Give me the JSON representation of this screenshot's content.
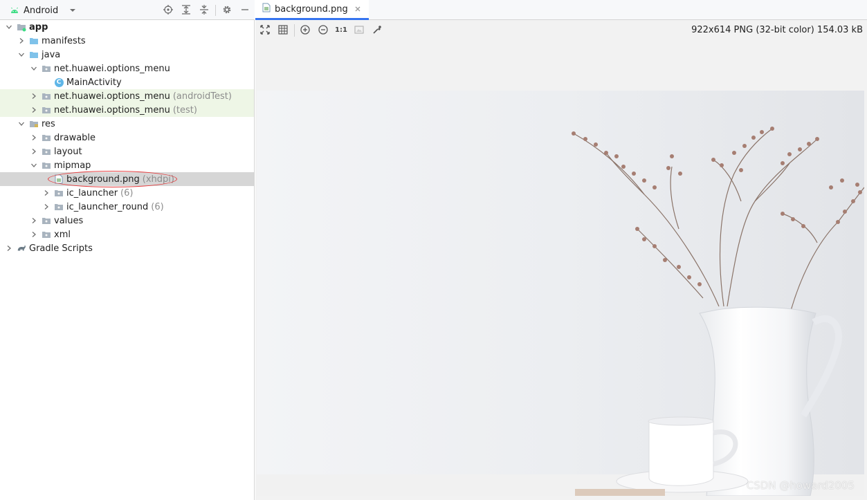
{
  "project_panel": {
    "view_label": "Android",
    "toolbar": [
      "locate-icon",
      "expand-all-icon",
      "collapse-all-icon",
      "gear-icon",
      "minimize-icon"
    ],
    "tree": [
      {
        "label": "app",
        "hint": "",
        "depth": 0,
        "expanded": true,
        "icon": "module-folder-icon",
        "bold": true
      },
      {
        "label": "manifests",
        "hint": "",
        "depth": 1,
        "expanded": false,
        "icon": "folder-icon"
      },
      {
        "label": "java",
        "hint": "",
        "depth": 1,
        "expanded": true,
        "icon": "folder-icon"
      },
      {
        "label": "net.huawei.options_menu",
        "hint": "",
        "depth": 2,
        "expanded": true,
        "icon": "package-icon"
      },
      {
        "label": "MainActivity",
        "hint": "",
        "depth": 3,
        "leaf": true,
        "icon": "class-icon"
      },
      {
        "label": "net.huawei.options_menu",
        "hint": "(androidTest)",
        "depth": 2,
        "expanded": false,
        "icon": "package-icon",
        "highlight": "green"
      },
      {
        "label": "net.huawei.options_menu",
        "hint": "(test)",
        "depth": 2,
        "expanded": false,
        "icon": "package-icon",
        "highlight": "green"
      },
      {
        "label": "res",
        "hint": "",
        "depth": 1,
        "expanded": true,
        "icon": "resources-folder-icon"
      },
      {
        "label": "drawable",
        "hint": "",
        "depth": 2,
        "expanded": false,
        "icon": "package-icon"
      },
      {
        "label": "layout",
        "hint": "",
        "depth": 2,
        "expanded": false,
        "icon": "package-icon"
      },
      {
        "label": "mipmap",
        "hint": "",
        "depth": 2,
        "expanded": true,
        "icon": "package-icon"
      },
      {
        "label": "background.png",
        "hint": "(xhdpi)",
        "depth": 3,
        "leaf": true,
        "icon": "image-file-icon",
        "selected": true
      },
      {
        "label": "ic_launcher",
        "hint": "(6)",
        "depth": 3,
        "expanded": false,
        "icon": "package-icon"
      },
      {
        "label": "ic_launcher_round",
        "hint": "(6)",
        "depth": 3,
        "expanded": false,
        "icon": "package-icon"
      },
      {
        "label": "values",
        "hint": "",
        "depth": 2,
        "expanded": false,
        "icon": "package-icon"
      },
      {
        "label": "xml",
        "hint": "",
        "depth": 2,
        "expanded": false,
        "icon": "package-icon"
      },
      {
        "label": "Gradle Scripts",
        "hint": "",
        "depth": 0,
        "expanded": false,
        "icon": "gradle-icon"
      }
    ]
  },
  "editor": {
    "tab": {
      "label": "background.png"
    },
    "toolbar": [
      "fit-zoom-icon",
      "grid-icon",
      "zoom-in-icon",
      "zoom-out-icon",
      "actual-size-icon",
      "background-icon",
      "color-picker-icon"
    ],
    "actual_size_label": "1:1",
    "image_info": "922x614 PNG (32-bit color) 154.03 kB",
    "watermark": "CSDN @howard2005"
  }
}
